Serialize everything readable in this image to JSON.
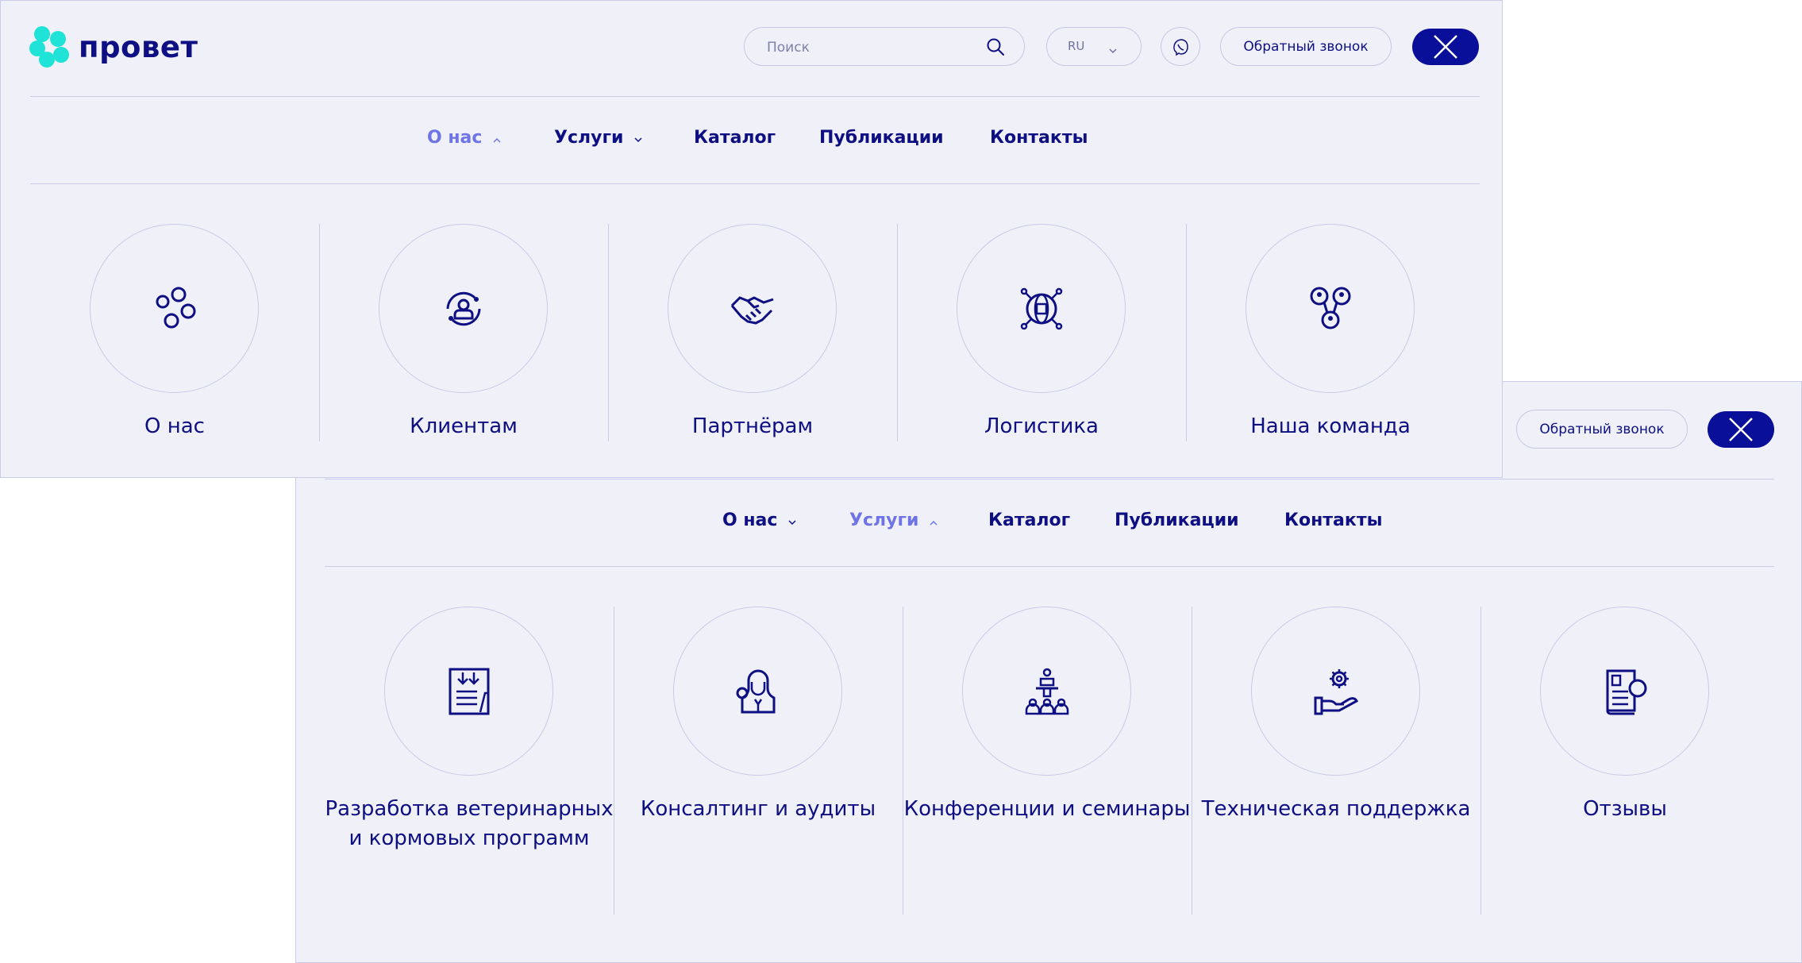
{
  "brand": {
    "name": "провет",
    "accent": "#1fe3d6",
    "primary": "#0d0f82",
    "active": "#6e74e6"
  },
  "header": {
    "search_placeholder": "Поиск",
    "lang": "RU",
    "callback": "Обратный звонок"
  },
  "panel_top": {
    "nav": [
      "О нас",
      "Услуги",
      "Каталог",
      "Публикации",
      "Контакты"
    ],
    "active_nav": "О нас",
    "items": [
      {
        "label": "О нас",
        "icon": "bubbles-icon"
      },
      {
        "label": "Клиентам",
        "icon": "client-cycle-icon"
      },
      {
        "label": "Партнёрам",
        "icon": "handshake-icon"
      },
      {
        "label": "Логистика",
        "icon": "globe-network-icon"
      },
      {
        "label": "Наша команда",
        "icon": "team-icon"
      }
    ]
  },
  "panel_bottom": {
    "callback": "Обратный звонок",
    "nav": [
      "О нас",
      "Услуги",
      "Каталог",
      "Публикации",
      "Контакты"
    ],
    "active_nav": "Услуги",
    "items": [
      {
        "label": "Разработка ветеринарных и кормовых программ",
        "icon": "document-development-icon"
      },
      {
        "label": "Консалтинг и аудиты",
        "icon": "consultant-icon"
      },
      {
        "label": "Конференции и семинары",
        "icon": "conference-icon"
      },
      {
        "label": "Техническая поддержка",
        "icon": "support-gear-icon"
      },
      {
        "label": "Отзывы",
        "icon": "review-document-icon"
      }
    ]
  }
}
